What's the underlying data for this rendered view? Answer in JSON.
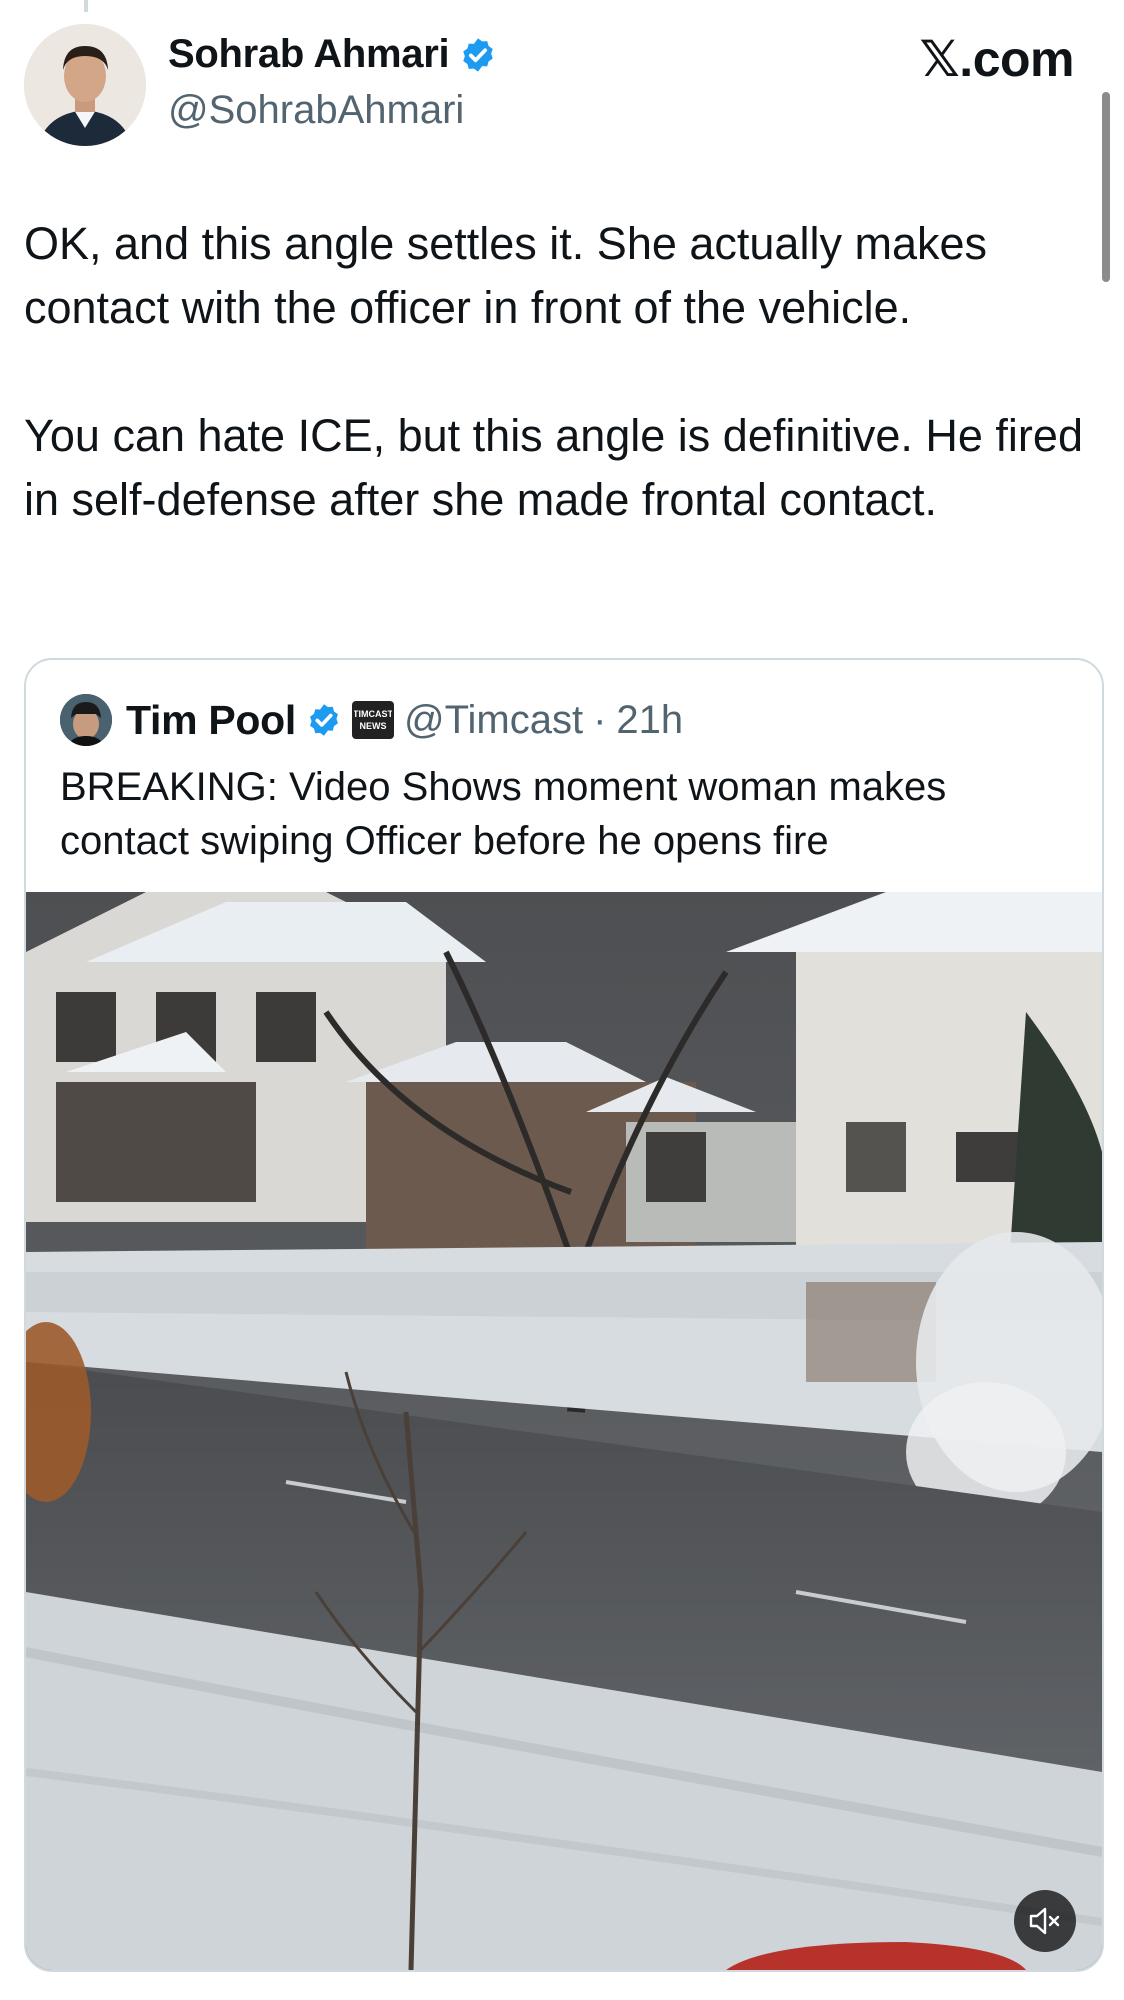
{
  "author": {
    "display_name": "Sohrab Ahmari",
    "handle": "@SohrabAhmari",
    "verified_color": "#1d9bf0"
  },
  "brand": "𝕏.com",
  "tweet": {
    "text": "OK, and this angle settles it. She actually makes contact with the officer in front of the vehicle.\n\nYou can hate ICE, but this angle is definitive. He fired in self-defense after she made frontal contact."
  },
  "quoted": {
    "display_name": "Tim Pool",
    "affiliate_label": "TIMCAST NEWS",
    "handle": "@Timcast",
    "separator": "·",
    "time": "21h",
    "text": "BREAKING: Video Shows moment woman makes contact swiping Officer before he opens fire"
  },
  "media": {
    "icons": [
      "mute-icon"
    ]
  }
}
